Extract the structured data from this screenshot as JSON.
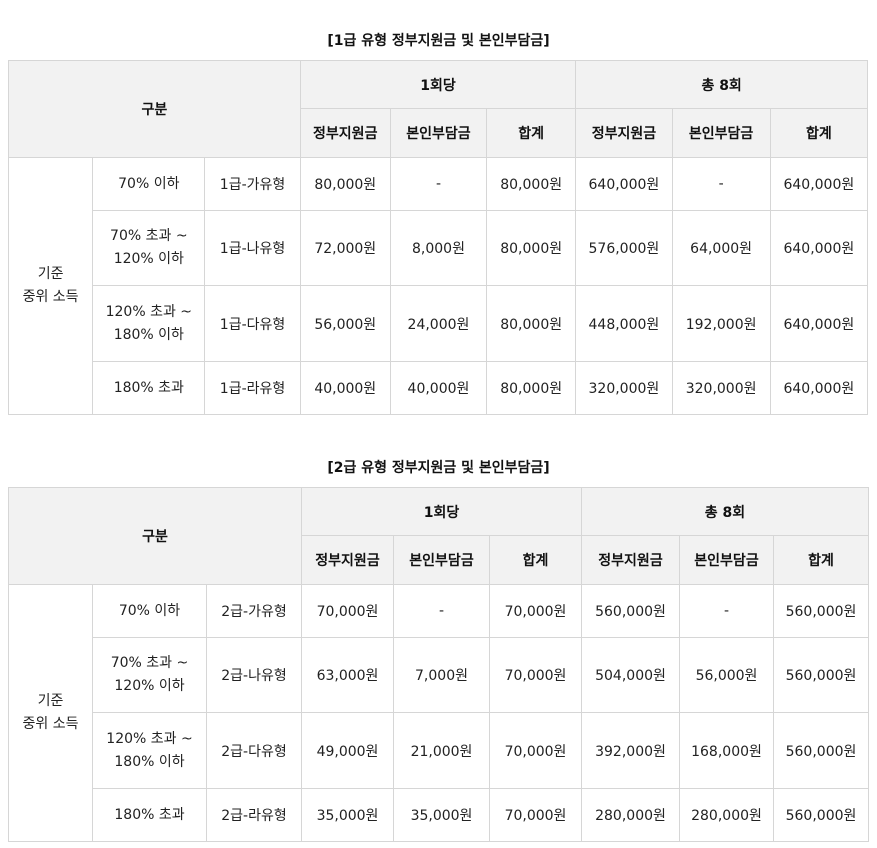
{
  "tables": [
    {
      "title": "[1급 유형 정부지원금 및 본인부담금]",
      "header": {
        "category": "구분",
        "group_per_visit": "1회당",
        "group_total": "총 8회",
        "col_gov": "정부지원금",
        "col_self": "본인부담금",
        "col_sum": "합계"
      },
      "row_group_label": [
        "기준",
        "중위 소득"
      ],
      "rows": [
        {
          "income": [
            "70% 이하"
          ],
          "type": "1급-가유형",
          "gov": "80,000원",
          "self": "-",
          "sum": "80,000원",
          "gov_total": "640,000원",
          "self_total": "-",
          "sum_total": "640,000원"
        },
        {
          "income": [
            "70% 초과 ~",
            "120% 이하"
          ],
          "type": "1급-나유형",
          "gov": "72,000원",
          "self": "8,000원",
          "sum": "80,000원",
          "gov_total": "576,000원",
          "self_total": "64,000원",
          "sum_total": "640,000원"
        },
        {
          "income": [
            "120% 초과 ~",
            "180% 이하"
          ],
          "type": "1급-다유형",
          "gov": "56,000원",
          "self": "24,000원",
          "sum": "80,000원",
          "gov_total": "448,000원",
          "self_total": "192,000원",
          "sum_total": "640,000원"
        },
        {
          "income": [
            "180% 초과"
          ],
          "type": "1급-라유형",
          "gov": "40,000원",
          "self": "40,000원",
          "sum": "80,000원",
          "gov_total": "320,000원",
          "self_total": "320,000원",
          "sum_total": "640,000원"
        }
      ]
    },
    {
      "title": "[2급 유형 정부지원금 및 본인부담금]",
      "header": {
        "category": "구분",
        "group_per_visit": "1회당",
        "group_total": "총 8회",
        "col_gov": "정부지원금",
        "col_self": "본인부담금",
        "col_sum": "합계"
      },
      "row_group_label": [
        "기준",
        "중위 소득"
      ],
      "rows": [
        {
          "income": [
            "70% 이하"
          ],
          "type": "2급-가유형",
          "gov": "70,000원",
          "self": "-",
          "sum": "70,000원",
          "gov_total": "560,000원",
          "self_total": "-",
          "sum_total": "560,000원"
        },
        {
          "income": [
            "70% 초과 ~",
            "120% 이하"
          ],
          "type": "2급-나유형",
          "gov": "63,000원",
          "self": "7,000원",
          "sum": "70,000원",
          "gov_total": "504,000원",
          "self_total": "56,000원",
          "sum_total": "560,000원"
        },
        {
          "income": [
            "120% 초과 ~",
            "180% 이하"
          ],
          "type": "2급-다유형",
          "gov": "49,000원",
          "self": "21,000원",
          "sum": "70,000원",
          "gov_total": "392,000원",
          "self_total": "168,000원",
          "sum_total": "560,000원"
        },
        {
          "income": [
            "180% 초과"
          ],
          "type": "2급-라유형",
          "gov": "35,000원",
          "self": "35,000원",
          "sum": "70,000원",
          "gov_total": "280,000원",
          "self_total": "280,000원",
          "sum_total": "560,000원"
        }
      ]
    }
  ]
}
